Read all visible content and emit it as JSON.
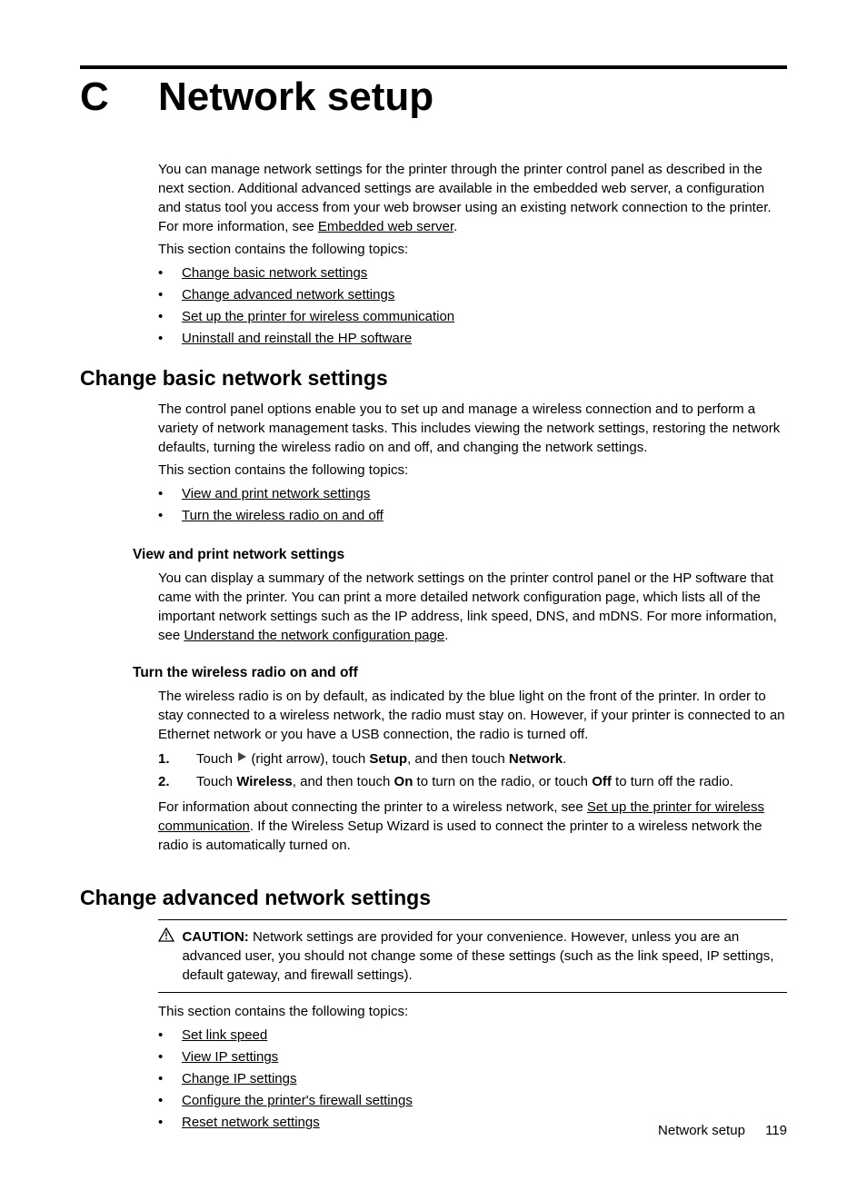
{
  "chapter": {
    "letter": "C",
    "title": "Network setup"
  },
  "intro": {
    "p1_a": "You can manage network settings for the printer through the printer control panel as described in the next section. Additional advanced settings are available in the embedded web server, a configuration and status tool you access from your web browser using an existing network connection to the printer. For more information, see ",
    "p1_link": "Embedded web server",
    "p1_b": ".",
    "p2": "This section contains the following topics:",
    "topics": {
      "t1": "Change basic network settings",
      "t2": "Change advanced network settings",
      "t3": "Set up the printer for wireless communication",
      "t4": "Uninstall and reinstall the HP software"
    }
  },
  "basic": {
    "heading": "Change basic network settings",
    "p1": "The control panel options enable you to set up and manage a wireless connection and to perform a variety of network management tasks. This includes viewing the network settings, restoring the network defaults, turning the wireless radio on and off, and changing the network settings.",
    "p2": "This section contains the following topics:",
    "topics": {
      "t1": "View and print network settings",
      "t2": "Turn the wireless radio on and off"
    },
    "viewprint": {
      "heading": "View and print network settings",
      "p1_a": "You can display a summary of the network settings on the printer control panel or the HP software that came with the printer. You can print a more detailed network configuration page, which lists all of the important network settings such as the IP address, link speed, DNS, and mDNS. For more information, see ",
      "p1_link": "Understand the network configuration page",
      "p1_b": "."
    },
    "radio": {
      "heading": "Turn the wireless radio on and off",
      "p1": "The wireless radio is on by default, as indicated by the blue light on the front of the printer. In order to stay connected to a wireless network, the radio must stay on. However, if your printer is connected to an Ethernet network or you have a USB connection, the radio is turned off.",
      "step1_num": "1.",
      "step1_a": "Touch ",
      "step1_b": " (right arrow), touch ",
      "step1_setup": "Setup",
      "step1_c": ", and then touch ",
      "step1_network": "Network",
      "step1_d": ".",
      "step2_num": "2.",
      "step2_a": "Touch ",
      "step2_wireless": "Wireless",
      "step2_b": ", and then touch ",
      "step2_on": "On",
      "step2_c": " to turn on the radio, or touch ",
      "step2_off": "Off",
      "step2_d": " to turn off the radio.",
      "p2_a": "For information about connecting the printer to a wireless network, see ",
      "p2_link": "Set up the printer for wireless communication",
      "p2_b": ". If the Wireless Setup Wizard is used to connect the printer to a wireless network the radio is automatically turned on."
    }
  },
  "advanced": {
    "heading": "Change advanced network settings",
    "caution_label": "CAUTION:",
    "caution_text": " Network settings are provided for your convenience. However, unless you are an advanced user, you should not change some of these settings (such as the link speed, IP settings, default gateway, and firewall settings).",
    "p1": "This section contains the following topics:",
    "topics": {
      "t1": "Set link speed",
      "t2": "View IP settings",
      "t3": "Change IP settings",
      "t4": "Configure the printer's firewall settings",
      "t5": "Reset network settings"
    }
  },
  "footer": {
    "label": "Network setup",
    "page": "119"
  }
}
